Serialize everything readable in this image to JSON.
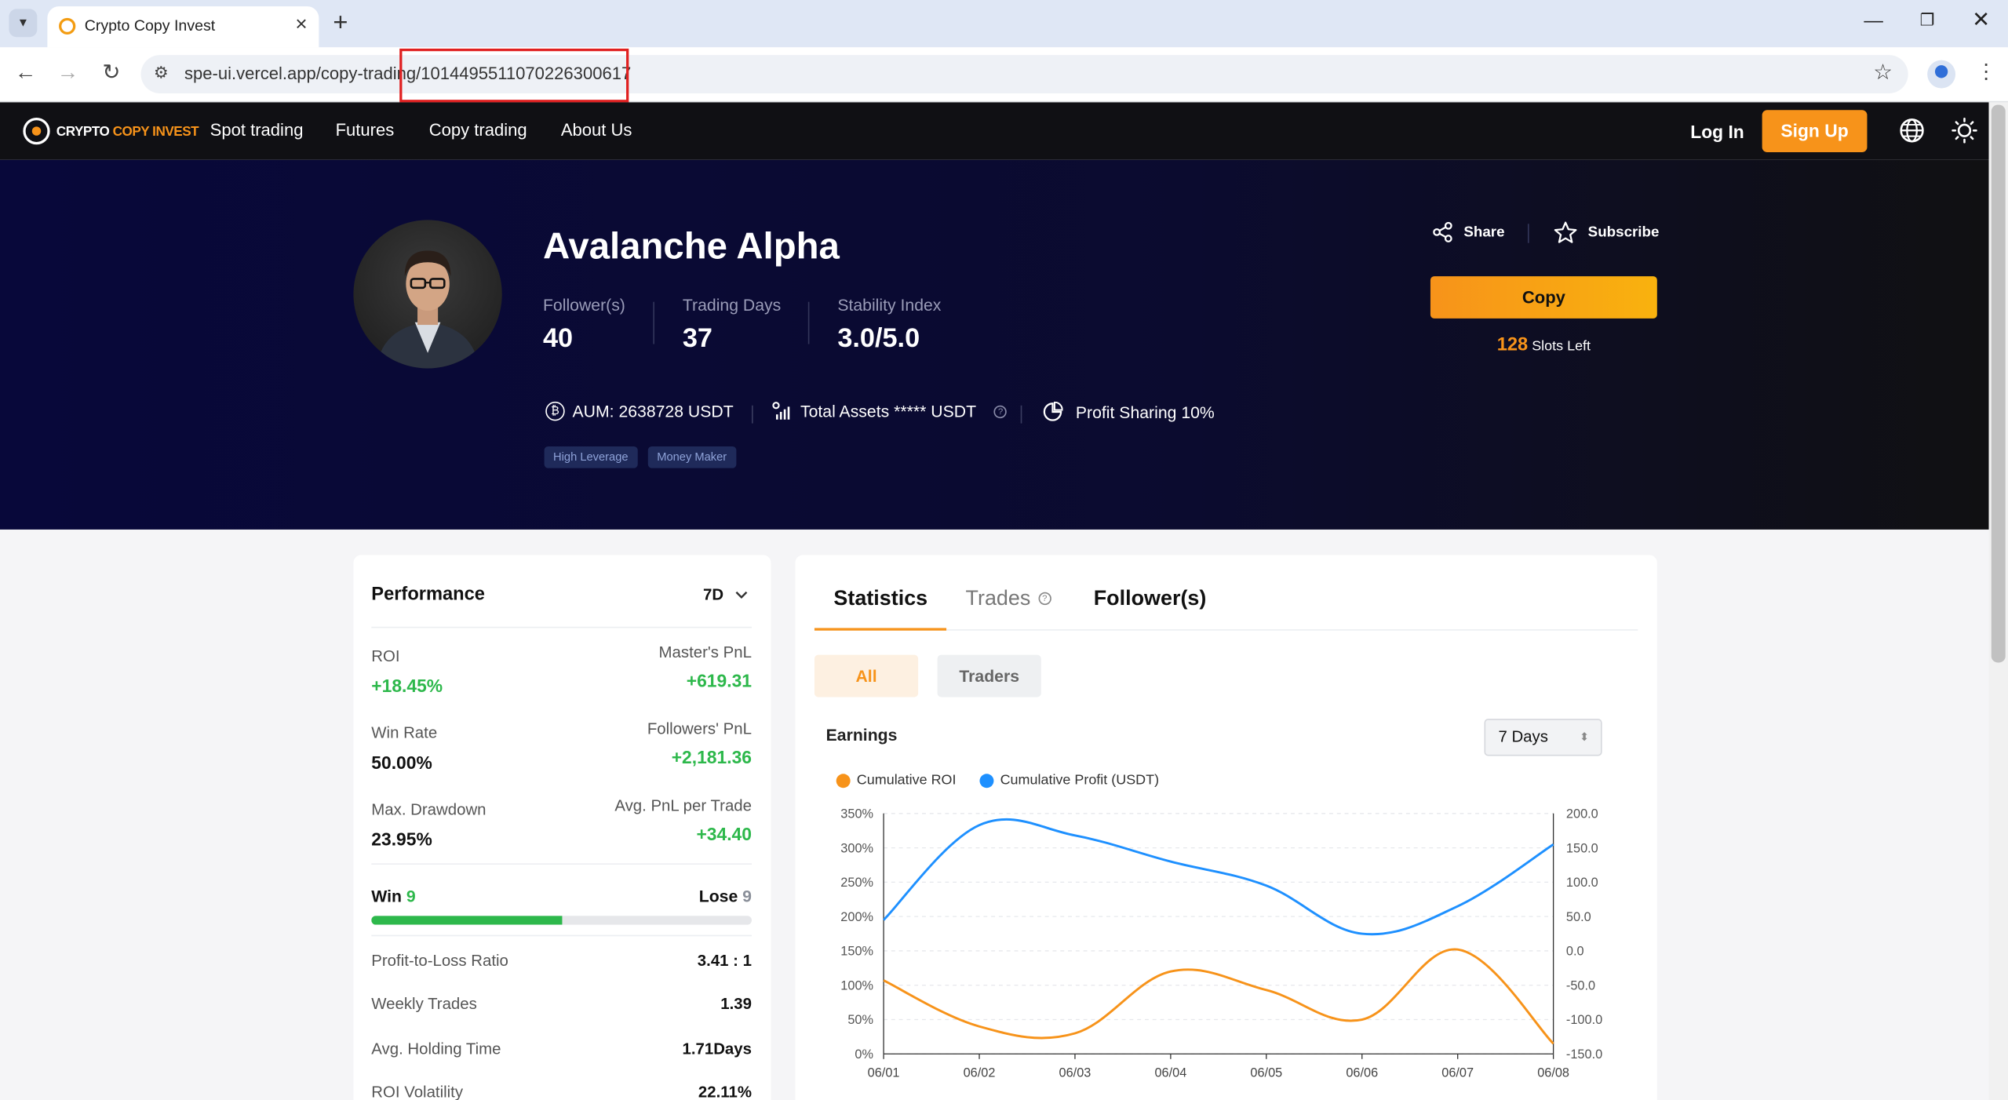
{
  "browser": {
    "tab_title": "Crypto Copy Invest",
    "url": "spe-ui.vercel.app/copy-trading/1014495511070226300617",
    "url_full": "spe-ui.vercel.app/copy-trading/1014495511070226300617 "
  },
  "site": {
    "logo_prefix": "CRYPTO ",
    "logo_accent": "COPY INVEST",
    "nav": [
      "Spot trading",
      "Futures",
      "Copy trading",
      "About Us"
    ],
    "login": "Log In",
    "signup": "Sign Up",
    "accent_color": "#f7931a"
  },
  "trader": {
    "name": "Avalanche Alpha",
    "stats": [
      {
        "label": "Follower(s)",
        "value": "40"
      },
      {
        "label": "Trading Days",
        "value": "37"
      },
      {
        "label": "Stability Index",
        "value": "3.0/5.0"
      }
    ],
    "aum": "AUM: 2638728 USDT",
    "total_assets": "Total Assets ***** USDT",
    "profit_sharing": "Profit Sharing 10%",
    "tags": [
      "High Leverage",
      "Money Maker"
    ],
    "share": "Share",
    "subscribe": "Subscribe",
    "copy": "Copy",
    "slots_count": "128",
    "slots_text": " Slots Left"
  },
  "performance": {
    "title": "Performance",
    "period": "7D",
    "metrics": [
      {
        "left_label": "ROI",
        "left_value": "+18.45%",
        "right_label": "Master's PnL",
        "right_value": "+619.31"
      },
      {
        "left_label": "Win Rate",
        "left_value": "50.00%",
        "right_label": "Followers' PnL",
        "right_value": "+2,181.36"
      },
      {
        "left_label": "Max. Drawdown",
        "left_value": "23.95%",
        "right_label": "Avg. PnL per Trade",
        "right_value": "+34.40"
      }
    ],
    "win_label": "Win",
    "win_count": "9",
    "lose_label": "Lose",
    "lose_count": "9",
    "win_fraction": 0.5,
    "rows": [
      {
        "label": "Profit-to-Loss Ratio",
        "value": "3.41 : 1"
      },
      {
        "label": "Weekly Trades",
        "value": "1.39"
      },
      {
        "label": "Avg. Holding Time",
        "value": "1.71Days"
      },
      {
        "label": "ROI Volatility",
        "value": "22.11%"
      }
    ]
  },
  "statistics": {
    "tabs": [
      "Statistics",
      "Trades",
      "Follower(s)"
    ],
    "filters": [
      "All",
      "Traders"
    ],
    "earnings_title": "Earnings",
    "range": "7 Days"
  },
  "chart_data": {
    "type": "line",
    "x": [
      "06/01",
      "06/02",
      "06/03",
      "06/04",
      "06/05",
      "06/06",
      "06/07",
      "06/08"
    ],
    "series": [
      {
        "name": "Cumulative ROI",
        "axis": "left",
        "color": "#f7931a",
        "values": [
          107,
          40,
          30,
          120,
          93,
          50,
          152,
          15
        ]
      },
      {
        "name": "Cumulative Profit (USDT)",
        "axis": "right",
        "color": "#1e90ff",
        "values": [
          45,
          183,
          168,
          130,
          95,
          25,
          65,
          155
        ]
      }
    ],
    "y_left": {
      "min": 0,
      "max": 350,
      "ticks": [
        "0%",
        "50%",
        "100%",
        "150%",
        "200%",
        "250%",
        "300%",
        "350%"
      ]
    },
    "y_right": {
      "min": -150,
      "max": 200,
      "ticks": [
        "-150.0",
        "-100.0",
        "-50.0",
        "0.0",
        "50.0",
        "100.0",
        "150.0",
        "200.0"
      ]
    },
    "grid": true,
    "legend": "top-left"
  }
}
